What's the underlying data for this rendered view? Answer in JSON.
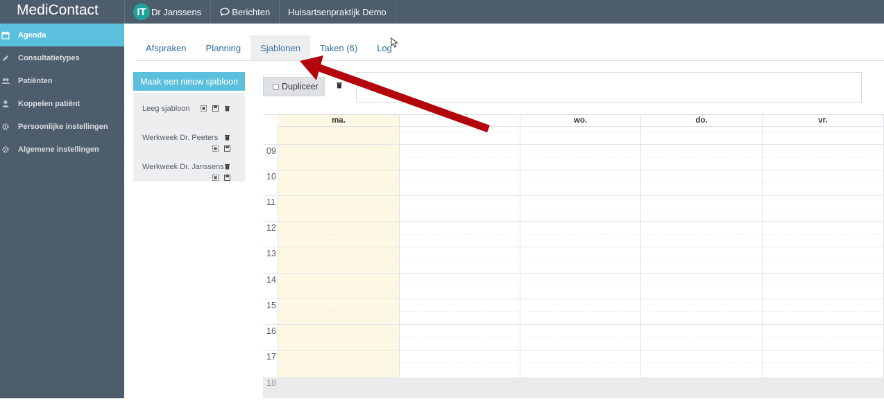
{
  "app": {
    "title": "MediContact"
  },
  "topnav": {
    "user": {
      "initials": "IT",
      "name": "Dr Janssens",
      "avatar_color": "#1fa398"
    },
    "messages": "Berichten",
    "practice": "Huisartsenpraktijk Demo"
  },
  "sidebar": {
    "items": [
      {
        "label": "Agenda",
        "icon": "calendar-icon",
        "active": true
      },
      {
        "label": "Consultatietypes",
        "icon": "pencil-icon"
      },
      {
        "label": "Patiënten",
        "icon": "users-icon"
      },
      {
        "label": "Koppelen patiënt",
        "icon": "user-icon"
      },
      {
        "label": "Persoonlijke instellingen",
        "icon": "gear-icon"
      },
      {
        "label": "Algemene instellingen",
        "icon": "gear-icon"
      }
    ]
  },
  "tabs": [
    {
      "label": "Afspraken"
    },
    {
      "label": "Planning"
    },
    {
      "label": "Sjablonen",
      "active": true
    },
    {
      "label": "Taken (6)"
    },
    {
      "label": "Log"
    }
  ],
  "templates": {
    "new_button": "Maak een nieuw sjabloon",
    "items": [
      {
        "label": "Leeg sjabloon"
      },
      {
        "label": "Werkweek Dr. Peeters"
      },
      {
        "label": "Werkweek Dr. Janssens"
      }
    ]
  },
  "toolbar": {
    "duplicate_label": "Dupliceer",
    "description_value": ""
  },
  "calendar": {
    "days": [
      "ma.",
      "",
      "wo.",
      "do.",
      "vr."
    ],
    "hours": [
      "09",
      "10",
      "11",
      "12",
      "13",
      "14",
      "15",
      "16",
      "17",
      "18"
    ],
    "highlight_color": "#fcf8e3"
  },
  "colors": {
    "accent": "#5bc0de",
    "nav": "#4e5d6c",
    "annotation_arrow": "#b3060c"
  }
}
